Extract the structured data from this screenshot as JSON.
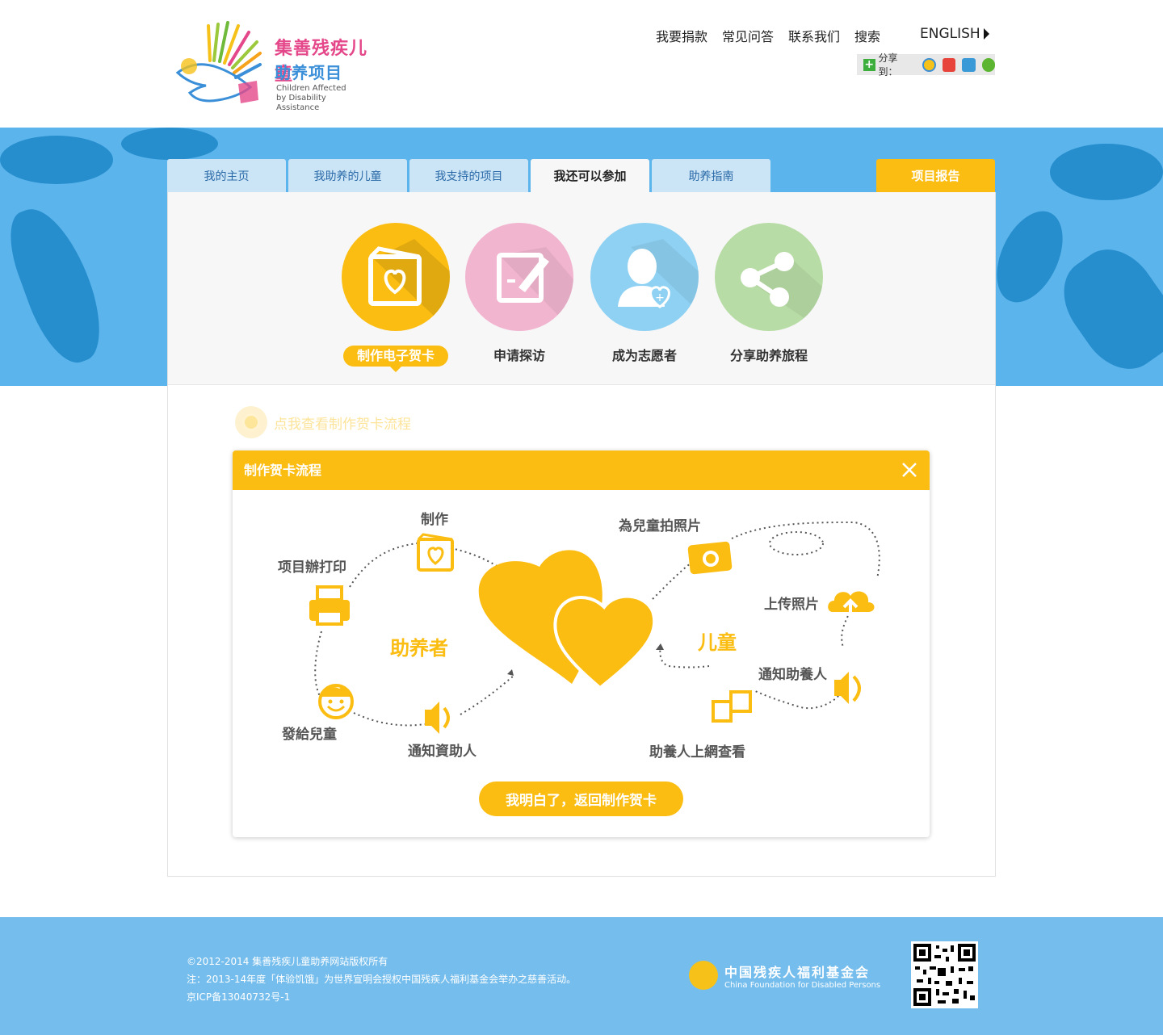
{
  "header": {
    "logo_cn_line1": "集善残疾儿童",
    "logo_cn_line2": "助养项目",
    "logo_en_line1": "Children Affected",
    "logo_en_line2": "by Disability Assistance",
    "nav": [
      "我要捐款",
      "常见问答",
      "联系我们",
      "搜索"
    ],
    "english": "ENGLISH",
    "share_label": "分享到："
  },
  "tabs": [
    "我的主页",
    "我助养的儿童",
    "我支持的项目",
    "我还可以参加",
    "助养指南"
  ],
  "active_tab": "我还可以参加",
  "report_tab": "项目报告",
  "actions": [
    {
      "label": "制作电子贺卡",
      "icon": "card-heart-icon",
      "color": "#fbbd12"
    },
    {
      "label": "申请探访",
      "icon": "form-pen-icon",
      "color": "#f2b5d0"
    },
    {
      "label": "成为志愿者",
      "icon": "volunteer-icon",
      "color": "#8fd1f3"
    },
    {
      "label": "分享助养旅程",
      "icon": "share-icon",
      "color": "#b8dca5"
    }
  ],
  "process_link": "点我查看制作贺卡流程",
  "modal": {
    "title": "制作贺卡流程",
    "labels": {
      "make": "制作",
      "print": "项目辦打印",
      "give": "發給兒童",
      "notify_sponsor": "通知資助人",
      "photo": "為兒童拍照片",
      "upload": "上传照片",
      "notify_adopter": "通知助養人",
      "view_online": "助養人上網查看"
    },
    "sponsor": "助养者",
    "child": "儿童",
    "confirm": "我明白了，返回制作贺卡"
  },
  "footer": {
    "copyright": "©2012-2014 集善残疾儿童助养网站版权所有",
    "note": "注：2013-14年度「体验饥饿」为世界宣明会授权中国残疾人福利基金会举办之慈善活动。",
    "icp": "京ICP备13040732号-1",
    "org_cn": "中国残疾人福利基金会",
    "org_en": "China Foundation for Disabled Persons"
  },
  "colors": {
    "accent": "#fbbd12",
    "banner": "#5cb4ec",
    "footer": "#74bdec",
    "tab": "#cbe5f6"
  }
}
